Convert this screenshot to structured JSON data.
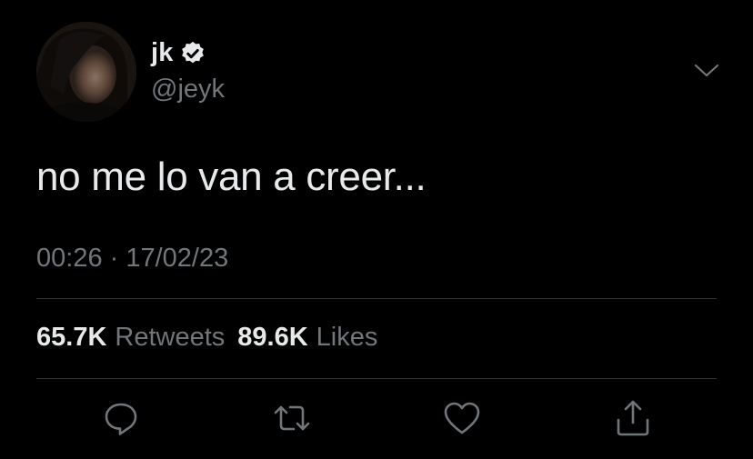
{
  "user": {
    "display_name": "jk",
    "handle": "@jeyk",
    "verified": true
  },
  "tweet": {
    "text": "no me lo van a creer...",
    "timestamp": "00:26 · 17/02/23"
  },
  "stats": {
    "retweets_count": "65.7K",
    "retweets_label": "Retweets",
    "likes_count": "89.6K",
    "likes_label": "Likes"
  },
  "actions": [
    "reply-icon",
    "retweet-icon",
    "like-icon",
    "share-icon"
  ],
  "colors": {
    "background": "#000000",
    "primary_text": "#e7e9ea",
    "secondary_text": "#71767b",
    "divider": "#2f3336"
  }
}
